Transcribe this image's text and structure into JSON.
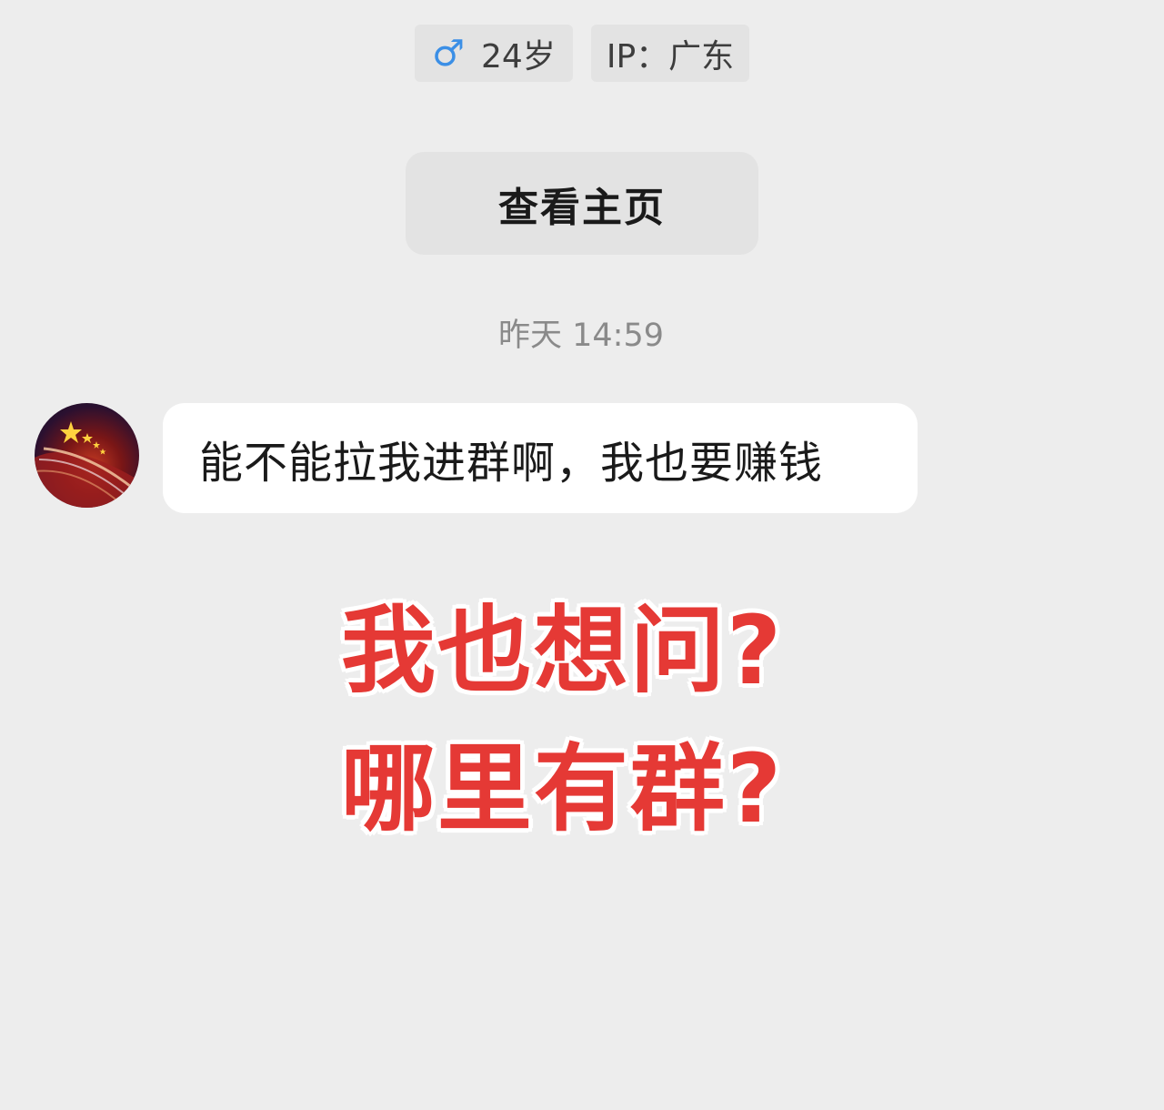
{
  "profile": {
    "gender_icon": "male-icon",
    "gender_symbol": "♂",
    "age": "24岁",
    "ip": "IP：广东"
  },
  "view_profile_button": "查看主页",
  "timestamp": "昨天 14:59",
  "message": {
    "avatar_icon": "flag-avatar",
    "text": "能不能拉我进群啊，我也要赚钱"
  },
  "overlay_caption": {
    "line1": "我也想问?",
    "line2": "哪里有群?",
    "color": "#e53935"
  },
  "colors": {
    "background": "#ededed",
    "tag_background": "#e3e3e3",
    "gender_icon": "#3b8fe6",
    "bubble": "#ffffff"
  }
}
